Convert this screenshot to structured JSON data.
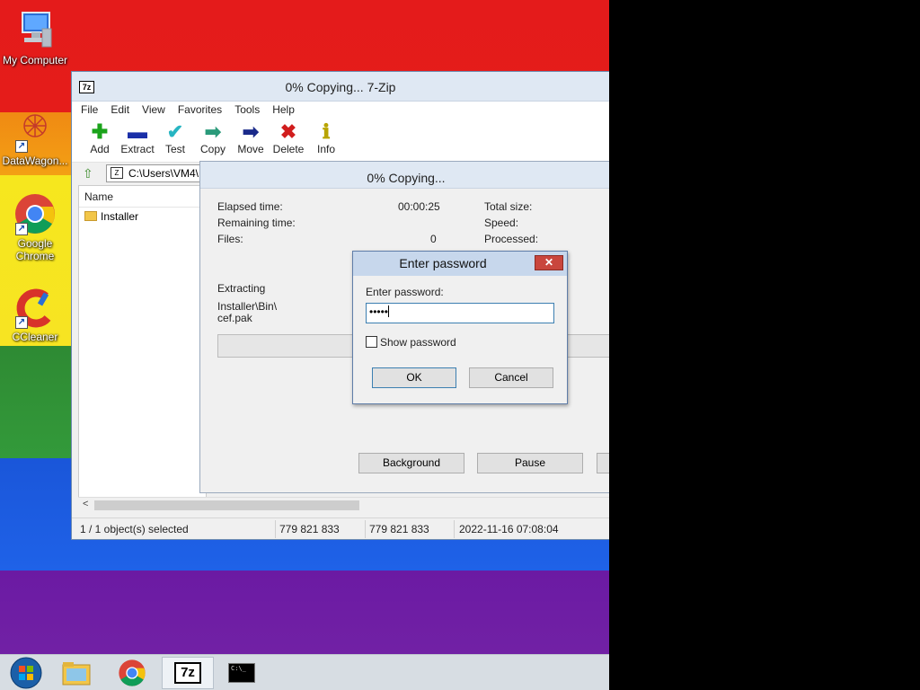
{
  "desktop": {
    "icons": [
      {
        "label": "My Computer"
      },
      {
        "label": "DataWagon..."
      },
      {
        "label_line1": "Google",
        "label_line2": "Chrome"
      },
      {
        "label": "CCleaner"
      }
    ]
  },
  "zip_window": {
    "logo": "7z",
    "title": "0% Copying... 7-Zip",
    "menu": [
      "File",
      "Edit",
      "View",
      "Favorites",
      "Tools",
      "Help"
    ],
    "toolbar": [
      {
        "label": "Add",
        "icon": "plus-icon",
        "glyph": "✚",
        "color": "#1aa31a"
      },
      {
        "label": "Extract",
        "icon": "minus-icon",
        "glyph": "▬",
        "color": "#1a2fa8"
      },
      {
        "label": "Test",
        "icon": "check-icon",
        "glyph": "✔",
        "color": "#27b5c2"
      },
      {
        "label": "Copy",
        "icon": "copy-arrow-icon",
        "glyph": "➡",
        "color": "#2a9a7a"
      },
      {
        "label": "Move",
        "icon": "move-arrow-icon",
        "glyph": "➡",
        "color": "#1a2a8a"
      },
      {
        "label": "Delete",
        "icon": "delete-x-icon",
        "glyph": "✖",
        "color": "#d11d1d"
      },
      {
        "label": "Info",
        "icon": "info-icon",
        "glyph": "ℹ",
        "color": "#b8a400"
      }
    ],
    "address": "C:\\Users\\VM4\\",
    "list_header": "Name",
    "list_items": [
      "Installer"
    ],
    "status": {
      "selected": "1 / 1 object(s) selected",
      "size": "779 821 833",
      "packed": "779 821 833",
      "modified": "2022-11-16 07:08:04"
    }
  },
  "progress_dialog": {
    "title": "0% Copying...",
    "elapsed_label": "Elapsed time:",
    "elapsed_value": "00:00:25",
    "remaining_label": "Remaining time:",
    "files_label": "Files:",
    "files_value": "0",
    "total_size_label": "Total size:",
    "speed_label": "Speed:",
    "processed_label": "Processed:",
    "extracting_label": "Extracting",
    "extracting_path_1": "Installer\\Bin\\",
    "extracting_path_2": "cef.pak",
    "progress_fraction": 0.0,
    "background_button": "Background",
    "pause_button": "Pause"
  },
  "password_dialog": {
    "title": "Enter password",
    "close_glyph": "✕",
    "prompt": "Enter password:",
    "value": "•••••",
    "show_password_label": "Show password",
    "show_password_checked": false,
    "ok_button": "OK",
    "cancel_button": "Cancel"
  },
  "taskbar": {
    "items": [
      {
        "icon": "windows-start-icon"
      },
      {
        "icon": "file-explorer-icon"
      },
      {
        "icon": "chrome-icon"
      },
      {
        "icon": "7zip-icon",
        "label": "7z",
        "active": true
      },
      {
        "icon": "command-prompt-icon",
        "label": "C:\\_"
      }
    ]
  }
}
